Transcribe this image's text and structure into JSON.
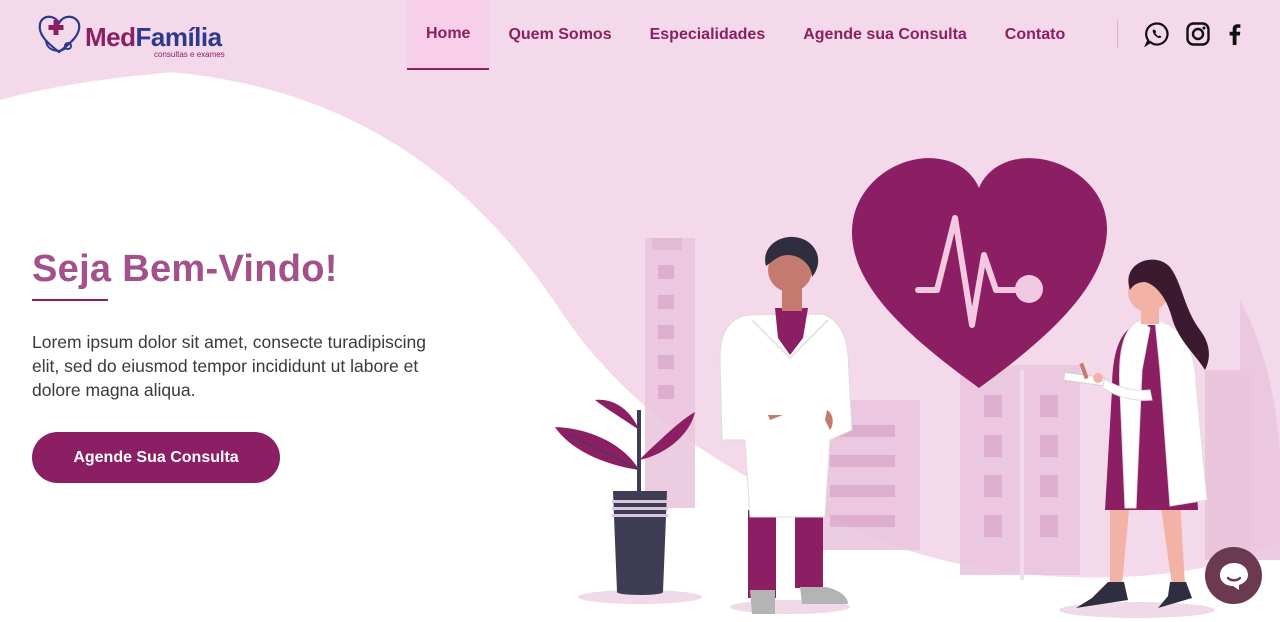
{
  "logo": {
    "word_part1": "Med",
    "word_part2": "Família",
    "tagline": "consultas e exames"
  },
  "nav": {
    "items": [
      {
        "label": "Home",
        "active": true
      },
      {
        "label": "Quem Somos"
      },
      {
        "label": "Especialidades"
      },
      {
        "label": "Agende sua Consulta"
      },
      {
        "label": "Contato"
      }
    ]
  },
  "social": {
    "icons": [
      "whatsapp-icon",
      "instagram-icon",
      "facebook-icon"
    ]
  },
  "hero": {
    "title": "Seja Bem-Vindo!",
    "text": "Lorem ipsum dolor sit amet, consecte turadipiscing elit, sed do eiusmod tempor incididunt ut labore et dolore magna aliqua.",
    "cta_label": "Agende Sua Consulta"
  },
  "colors": {
    "primary": "#8c1e64",
    "header_bg": "#f4d9eb",
    "title": "#a2518a",
    "logo_blue": "#2b3a8c",
    "chat_bg": "#6b3a50"
  }
}
